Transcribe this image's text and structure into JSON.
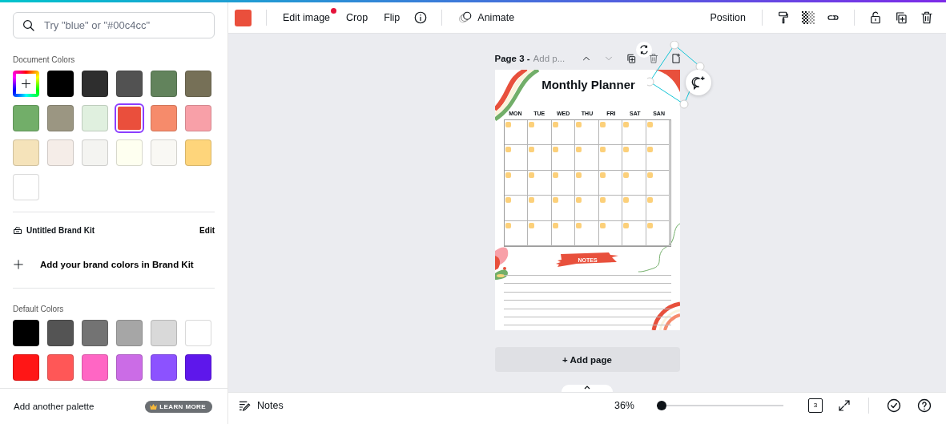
{
  "sidebar": {
    "search": {
      "placeholder": "Try \"blue\" or \"#00c4cc\""
    },
    "document_colors": {
      "title": "Document Colors",
      "swatches": [
        {
          "kind": "add",
          "selected": false
        },
        {
          "kind": "swatch",
          "color": "#000000",
          "selected": false
        },
        {
          "kind": "swatch",
          "color": "#2e2e2e",
          "selected": false
        },
        {
          "kind": "swatch",
          "color": "#525252",
          "selected": false
        },
        {
          "kind": "swatch",
          "color": "#62835c",
          "selected": false
        },
        {
          "kind": "swatch",
          "color": "#767057",
          "selected": false
        },
        {
          "kind": "swatch",
          "color": "#72ae69",
          "selected": false
        },
        {
          "kind": "swatch",
          "color": "#9b9682",
          "selected": false
        },
        {
          "kind": "swatch",
          "color": "#e0f0df",
          "selected": false
        },
        {
          "kind": "swatch",
          "color": "#ea4f3c",
          "selected": true
        },
        {
          "kind": "swatch",
          "color": "#f68b6b",
          "selected": false
        },
        {
          "kind": "swatch",
          "color": "#f8a0a8",
          "selected": false
        },
        {
          "kind": "swatch",
          "color": "#f5e3ba",
          "selected": false
        },
        {
          "kind": "swatch",
          "color": "#f5ede8",
          "selected": false
        },
        {
          "kind": "swatch",
          "color": "#f4f4f1",
          "selected": false
        },
        {
          "kind": "swatch",
          "color": "#fefff0",
          "selected": false
        },
        {
          "kind": "swatch",
          "color": "#f9f8f4",
          "selected": false
        },
        {
          "kind": "swatch",
          "color": "#fed57b",
          "selected": false
        },
        {
          "kind": "swatch",
          "color": "#ffffff",
          "selected": false
        }
      ]
    },
    "brand_kit": {
      "title": "Untitled Brand Kit",
      "edit": "Edit",
      "add_label": "Add your brand colors in Brand Kit"
    },
    "default_colors": {
      "title": "Default Colors",
      "swatches": [
        {
          "color": "#000000",
          "selected": false
        },
        {
          "color": "#545454",
          "selected": false
        },
        {
          "color": "#737373",
          "selected": false
        },
        {
          "color": "#a6a6a6",
          "selected": false
        },
        {
          "color": "#d9d9d9",
          "selected": false
        },
        {
          "color": "#ffffff",
          "selected": false
        },
        {
          "color": "#ff1616",
          "selected": false
        },
        {
          "color": "#ff5757",
          "selected": false
        },
        {
          "color": "#ff66c4",
          "selected": false
        },
        {
          "color": "#cb6ce6",
          "selected": false
        },
        {
          "color": "#8c52ff",
          "selected": false
        },
        {
          "color": "#5e17eb",
          "selected": false
        }
      ]
    },
    "footer": {
      "label": "Add another palette",
      "badge": "LEARN MORE"
    }
  },
  "toolbar": {
    "color": "#ea4f3c",
    "items": [
      {
        "kind": "text",
        "label": "Edit image",
        "notification": true
      },
      {
        "kind": "text",
        "label": "Crop",
        "notification": false
      },
      {
        "kind": "text",
        "label": "Flip",
        "notification": false
      },
      {
        "kind": "info",
        "notification": false
      },
      {
        "kind": "animate",
        "label": "Animate",
        "notification": false
      }
    ],
    "position": "Position"
  },
  "page": {
    "label": "Page 3 -",
    "title_placeholder": "Add p...",
    "planner": {
      "title": "Monthly Planner",
      "days": [
        "MON",
        "TUE",
        "WED",
        "THU",
        "FRI",
        "SAT",
        "SAN"
      ],
      "notes": "NOTES"
    },
    "add_page": "+ Add page"
  },
  "status_bar": {
    "notes": "Notes",
    "zoom": "36%",
    "zoom_slider": {
      "level": 0.04
    },
    "page_count": "3"
  }
}
